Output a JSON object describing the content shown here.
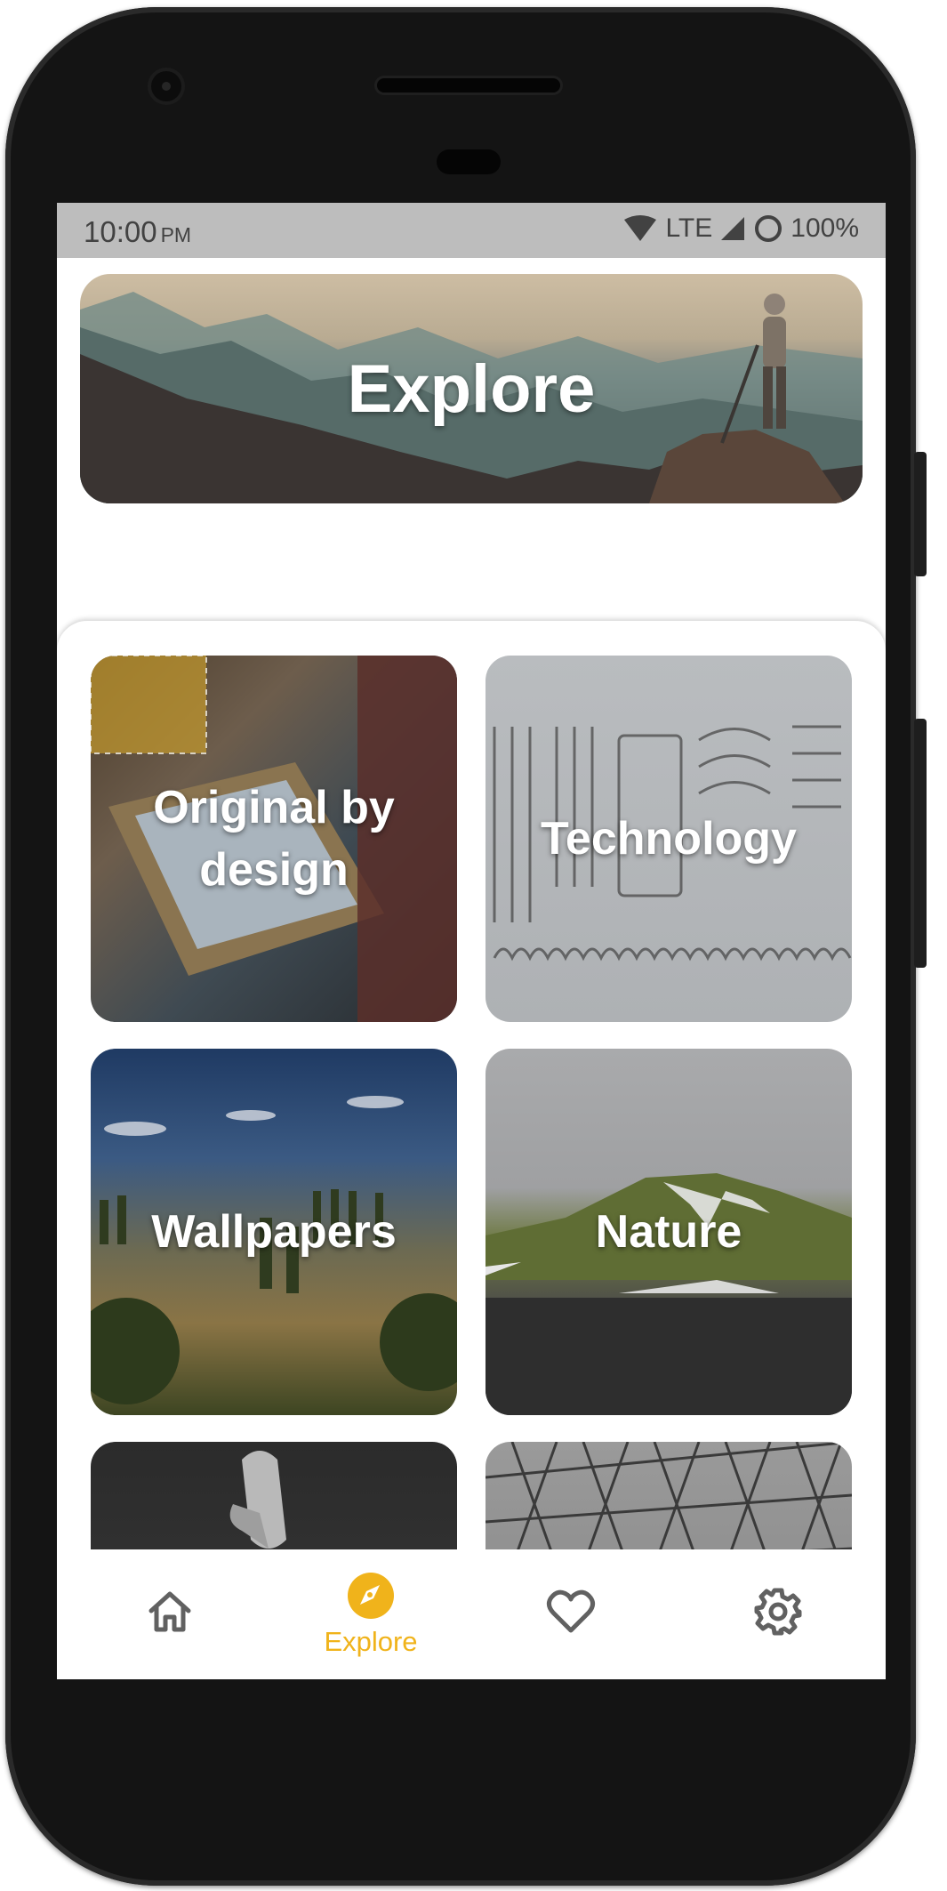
{
  "status_bar": {
    "time": "10:00",
    "ampm": "PM",
    "network": "LTE",
    "battery": "100%"
  },
  "hero": {
    "title": "Explore"
  },
  "categories": [
    {
      "label": "Original by design"
    },
    {
      "label": "Technology"
    },
    {
      "label": "Wallpapers"
    },
    {
      "label": "Nature"
    },
    {
      "label": ""
    },
    {
      "label": ""
    }
  ],
  "nav": {
    "items": [
      {
        "icon": "home-icon",
        "label": ""
      },
      {
        "icon": "compass-icon",
        "label": "Explore",
        "active": true
      },
      {
        "icon": "heart-icon",
        "label": ""
      },
      {
        "icon": "gear-icon",
        "label": ""
      }
    ]
  },
  "colors": {
    "accent": "#f0b31b",
    "status_bar": "#bdbdbd",
    "icon": "#616161"
  }
}
